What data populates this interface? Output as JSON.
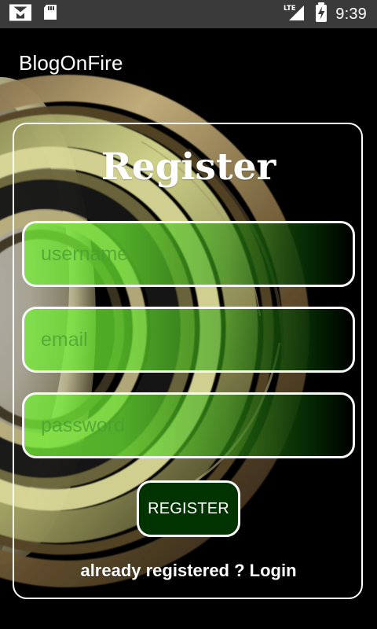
{
  "status_bar": {
    "left_icons": [
      "gmail-icon",
      "sd-card-icon"
    ],
    "network_label": "LTE",
    "right_icons": [
      "lte-signal-icon",
      "battery-charging-icon"
    ],
    "time": "9:39"
  },
  "app": {
    "title": "BlogOnFire"
  },
  "register_form": {
    "heading": "Register",
    "username": {
      "value": "",
      "placeholder": "username"
    },
    "email": {
      "value": "",
      "placeholder": "email"
    },
    "password": {
      "value": "",
      "placeholder": "password"
    },
    "submit_label": "REGISTER",
    "login_link_label": "already registered ? Login"
  },
  "colors": {
    "status_bar": "#3a3a3a",
    "background": "#000000",
    "field_green": "#75f036",
    "button_dark_green": "#003300",
    "text": "#ffffff"
  },
  "background": {
    "image": "saturn-rings-image"
  }
}
